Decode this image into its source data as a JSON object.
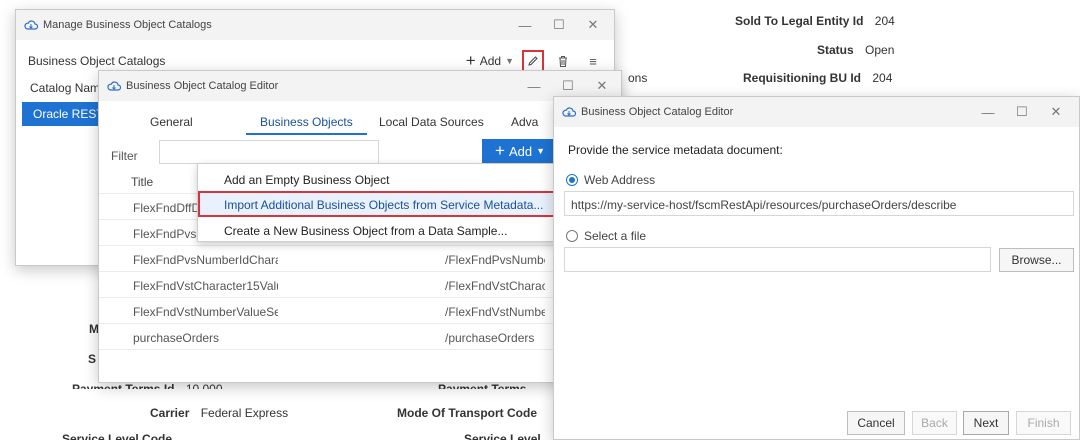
{
  "background": {
    "fields": [
      {
        "label": "Sold To Legal Entity Id",
        "value": "204"
      },
      {
        "label": "Status",
        "value": "Open"
      },
      {
        "label": "Requisitioning BU Id",
        "value": "204"
      },
      {
        "label": "Carrier",
        "value": "Federal Express"
      },
      {
        "label": "Mode Of Transport Code",
        "value": ""
      }
    ],
    "fragments": {
      "ons": "ons",
      "m": "M",
      "s": "S",
      "payment_terms_id": "Payment Terms Id",
      "payment_terms_id_value": "10,000",
      "payment_terms": "Payment Terms",
      "service_level_code": "Service Level Code",
      "service_level": "Service Level"
    }
  },
  "catalogs_window": {
    "title": "Manage Business Object Catalogs",
    "header": "Business Object Catalogs",
    "add_label": "Add",
    "column_header": "Catalog Name",
    "selected_row": "Oracle REST API"
  },
  "editor_window": {
    "title": "Business Object Catalog Editor",
    "tabs": [
      "General",
      "Business Objects",
      "Local Data Sources",
      "Adva"
    ],
    "filter_label": "Filter",
    "add_label": "Add",
    "title_header": "Title",
    "rows": [
      {
        "title": "FlexFndDffD",
        "path": ""
      },
      {
        "title": "FlexFndPvsC",
        "path": ""
      },
      {
        "title": "FlexFndPvsNumberIdChara",
        "path": "/FlexFndPvsNumberI"
      },
      {
        "title": "FlexFndVstCharacter15Valu",
        "path": "/FlexFndVstCharacte"
      },
      {
        "title": "FlexFndVstNumberValueSe",
        "path": "/FlexFndVstNumberV"
      },
      {
        "title": "purchaseOrders",
        "path": "/purchaseOrders"
      }
    ]
  },
  "add_menu": {
    "items": [
      "Add an Empty Business Object",
      "Import Additional Business Objects from Service Metadata...",
      "Create a New Business Object from a Data Sample..."
    ]
  },
  "metadata_window": {
    "title": "Business Object Catalog Editor",
    "prompt": "Provide the service metadata document:",
    "web_address_label": "Web Address",
    "web_address_value": "https://my-service-host/fscmRestApi/resources/purchaseOrders/describe",
    "file_label": "Select a file",
    "file_value": "",
    "browse_label": "Browse...",
    "buttons": {
      "cancel": "Cancel",
      "back": "Back",
      "next": "Next",
      "finish": "Finish"
    }
  },
  "colors": {
    "accent": "#1e73d2",
    "highlight_border": "#d9343c"
  }
}
